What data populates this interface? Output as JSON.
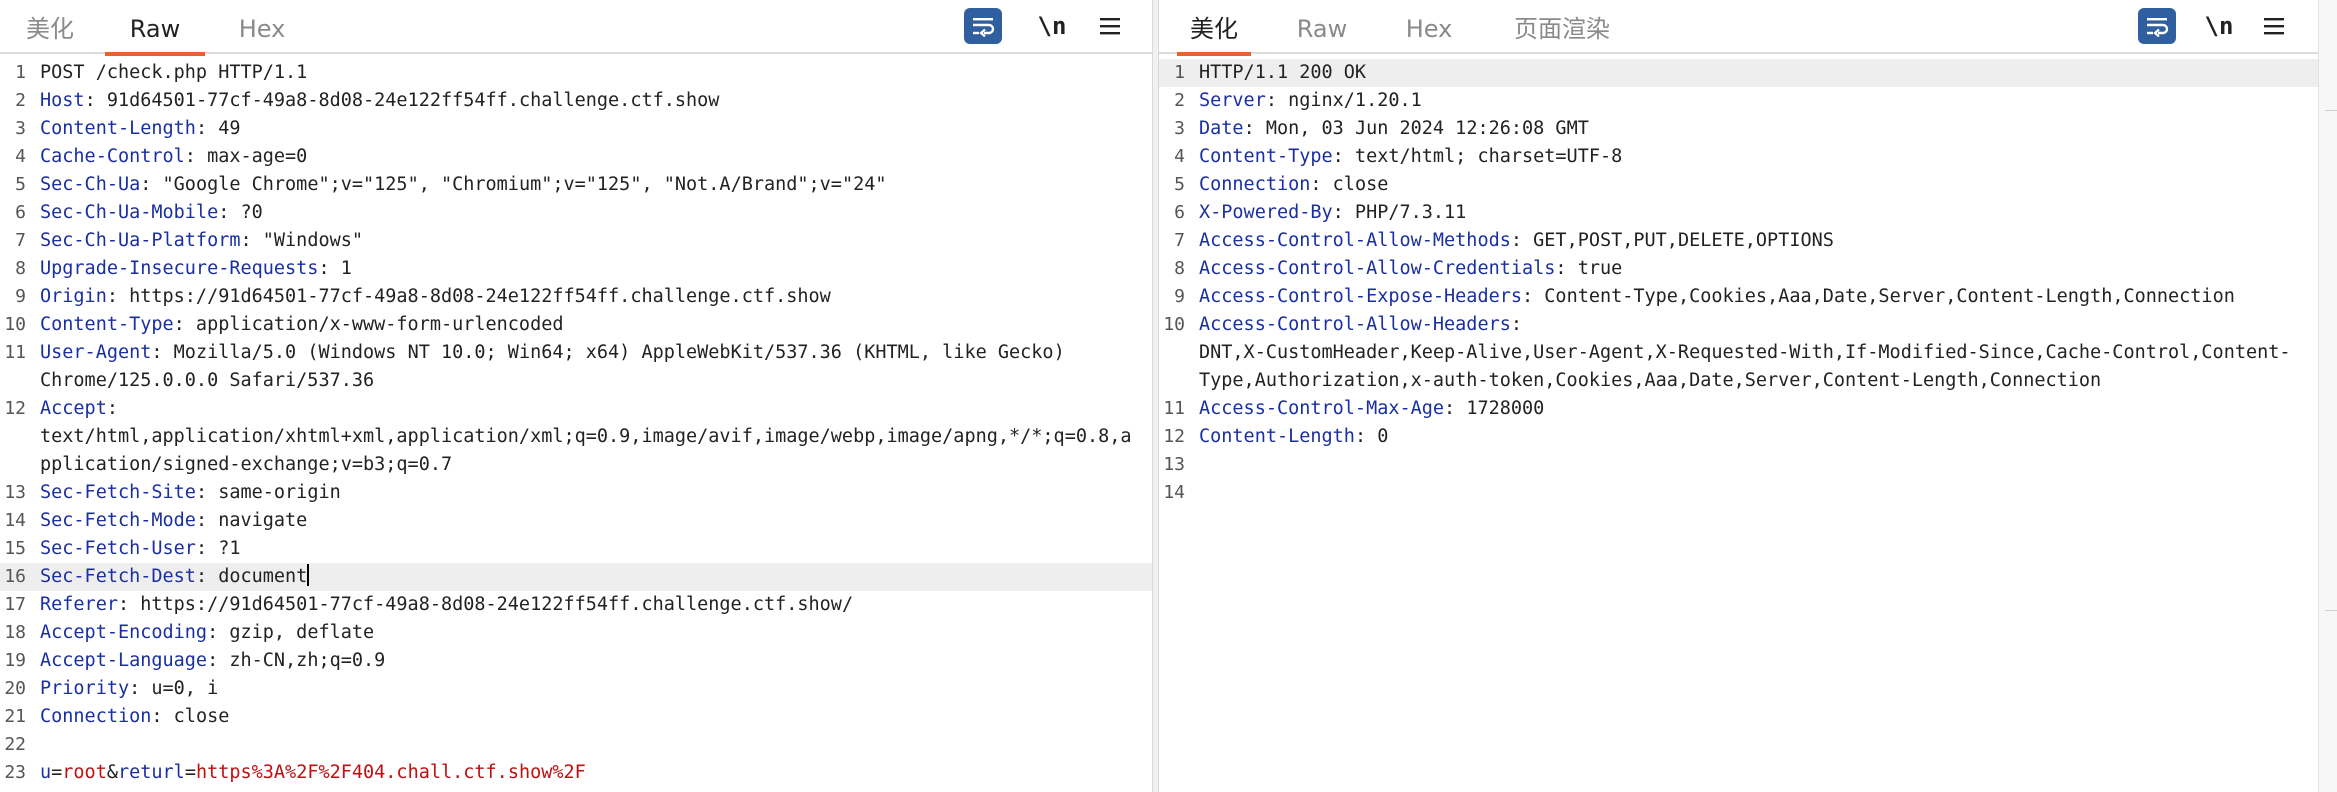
{
  "request": {
    "tabs": [
      {
        "label": "美化",
        "active": false
      },
      {
        "label": "Raw",
        "active": true
      },
      {
        "label": "Hex",
        "active": false
      }
    ],
    "newline_label": "\\n",
    "lines": [
      {
        "num": "1",
        "plain": "POST /check.php HTTP/1.1"
      },
      {
        "num": "2",
        "key": "Host",
        "value": " 91d64501-77cf-49a8-8d08-24e122ff54ff.challenge.ctf.show"
      },
      {
        "num": "3",
        "key": "Content-Length",
        "value": " 49"
      },
      {
        "num": "4",
        "key": "Cache-Control",
        "value": " max-age=0"
      },
      {
        "num": "5",
        "key": "Sec-Ch-Ua",
        "value": " \"Google Chrome\";v=\"125\", \"Chromium\";v=\"125\", \"Not.A/Brand\";v=\"24\""
      },
      {
        "num": "6",
        "key": "Sec-Ch-Ua-Mobile",
        "value": " ?0"
      },
      {
        "num": "7",
        "key": "Sec-Ch-Ua-Platform",
        "value": " \"Windows\""
      },
      {
        "num": "8",
        "key": "Upgrade-Insecure-Requests",
        "value": " 1"
      },
      {
        "num": "9",
        "key": "Origin",
        "value": " https://91d64501-77cf-49a8-8d08-24e122ff54ff.challenge.ctf.show"
      },
      {
        "num": "10",
        "key": "Content-Type",
        "value": " application/x-www-form-urlencoded"
      },
      {
        "num": "11",
        "key": "User-Agent",
        "value": " Mozilla/5.0 (Windows NT 10.0; Win64; x64) AppleWebKit/537.36 (KHTML, like Gecko)"
      },
      {
        "num": "",
        "plain": "Chrome/125.0.0.0 Safari/537.36"
      },
      {
        "num": "12",
        "key": "Accept",
        "value": ""
      },
      {
        "num": "",
        "plain": "text/html,application/xhtml+xml,application/xml;q=0.9,image/avif,image/webp,image/apng,*/*;q=0.8,a"
      },
      {
        "num": "",
        "plain": "pplication/signed-exchange;v=b3;q=0.7"
      },
      {
        "num": "13",
        "key": "Sec-Fetch-Site",
        "value": " same-origin"
      },
      {
        "num": "14",
        "key": "Sec-Fetch-Mode",
        "value": " navigate"
      },
      {
        "num": "15",
        "key": "Sec-Fetch-User",
        "value": " ?1"
      },
      {
        "num": "16",
        "key": "Sec-Fetch-Dest",
        "value": " document",
        "highlight": true,
        "caret": true
      },
      {
        "num": "17",
        "key": "Referer",
        "value": " https://91d64501-77cf-49a8-8d08-24e122ff54ff.challenge.ctf.show/"
      },
      {
        "num": "18",
        "key": "Accept-Encoding",
        "value": " gzip, deflate"
      },
      {
        "num": "19",
        "key": "Accept-Language",
        "value": " zh-CN,zh;q=0.9"
      },
      {
        "num": "20",
        "key": "Priority",
        "value": " u=0, i"
      },
      {
        "num": "21",
        "key": "Connection",
        "value": " close"
      },
      {
        "num": "22",
        "plain": ""
      },
      {
        "num": "23",
        "params": [
          {
            "k": "u",
            "v": "root"
          },
          {
            "k": "returl",
            "v": "https%3A%2F%2F404.chall.ctf.show%2F"
          }
        ]
      }
    ]
  },
  "response": {
    "tabs": [
      {
        "label": "美化",
        "active": true
      },
      {
        "label": "Raw",
        "active": false
      },
      {
        "label": "Hex",
        "active": false
      },
      {
        "label": "页面渲染",
        "active": false
      }
    ],
    "newline_label": "\\n",
    "lines": [
      {
        "num": "1",
        "plain": "HTTP/1.1 200 OK",
        "highlight": true
      },
      {
        "num": "2",
        "key": "Server",
        "value": " nginx/1.20.1"
      },
      {
        "num": "3",
        "key": "Date",
        "value": " Mon, 03 Jun 2024 12:26:08 GMT"
      },
      {
        "num": "4",
        "key": "Content-Type",
        "value": " text/html; charset=UTF-8"
      },
      {
        "num": "5",
        "key": "Connection",
        "value": " close"
      },
      {
        "num": "6",
        "key": "X-Powered-By",
        "value": " PHP/7.3.11"
      },
      {
        "num": "7",
        "key": "Access-Control-Allow-Methods",
        "value": " GET,POST,PUT,DELETE,OPTIONS"
      },
      {
        "num": "8",
        "key": "Access-Control-Allow-Credentials",
        "value": " true"
      },
      {
        "num": "9",
        "key": "Access-Control-Expose-Headers",
        "value": " Content-Type,Cookies,Aaa,Date,Server,Content-Length,Connection"
      },
      {
        "num": "10",
        "key": "Access-Control-Allow-Headers",
        "value": ""
      },
      {
        "num": "",
        "plain": "DNT,X-CustomHeader,Keep-Alive,User-Agent,X-Requested-With,If-Modified-Since,Cache-Control,Content-"
      },
      {
        "num": "",
        "plain": "Type,Authorization,x-auth-token,Cookies,Aaa,Date,Server,Content-Length,Connection"
      },
      {
        "num": "11",
        "key": "Access-Control-Max-Age",
        "value": " 1728000"
      },
      {
        "num": "12",
        "key": "Content-Length",
        "value": " 0"
      },
      {
        "num": "13",
        "plain": ""
      },
      {
        "num": "14",
        "plain": ""
      }
    ]
  },
  "colors": {
    "header_key": "#1a2fa0",
    "param_value": "#c01010",
    "active_tab_underline": "#e8622d",
    "wrap_button": "#2f5f9f"
  }
}
